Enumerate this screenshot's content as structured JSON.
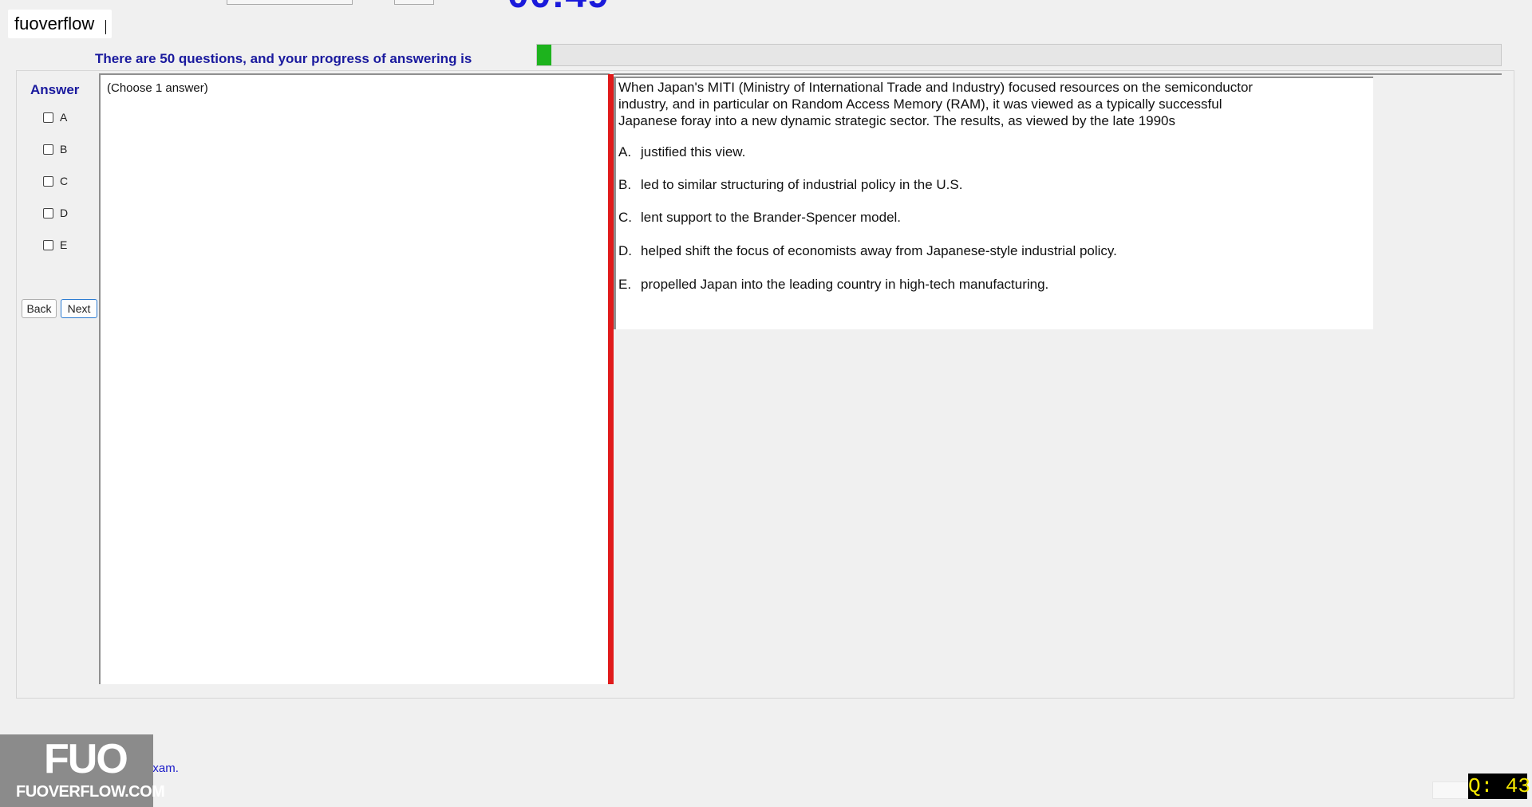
{
  "watermark": {
    "top_text": "fuoverflow"
  },
  "progress": {
    "label": "There are 50 questions, and your progress of answering is",
    "fraction": 0.015,
    "color": "#1db31d"
  },
  "answer_panel": {
    "title": "Answer",
    "options": [
      "A",
      "B",
      "C",
      "D",
      "E"
    ]
  },
  "nav": {
    "back_label": "Back",
    "next_label": "Next"
  },
  "answer_area": {
    "instruction": "(Choose 1 answer)"
  },
  "question": {
    "text_lines": [
      "When Japan's MITI (Ministry of International Trade and Industry) focused resources on the semiconductor",
      "industry, and in particular on Random Access Memory (RAM), it was viewed as a typically successful",
      "Japanese foray into a new dynamic strategic sector. The results, as viewed by the late 1990s"
    ],
    "options": [
      {
        "letter": "A.",
        "text": "justified this view."
      },
      {
        "letter": "B.",
        "text": "led to similar structuring of industrial policy in the U.S."
      },
      {
        "letter": "C.",
        "text": "lent support to the Brander-Spencer model."
      },
      {
        "letter": "D.",
        "text": "helped shift the focus of economists away from Japanese-style industrial policy."
      },
      {
        "letter": "E.",
        "text": "propelled Japan into the leading country in high-tech manufacturing."
      }
    ]
  },
  "finish": {
    "label": "I want to finish the exam."
  },
  "logo": {
    "mark": "FUO",
    "site": "FUOVERFLOW.COM"
  },
  "indicator": {
    "text": "Q: 43"
  },
  "colors": {
    "accent_blue": "#1a1a9e",
    "splitter_red": "#e01b1b",
    "indicator_yellow": "#f5e800"
  }
}
